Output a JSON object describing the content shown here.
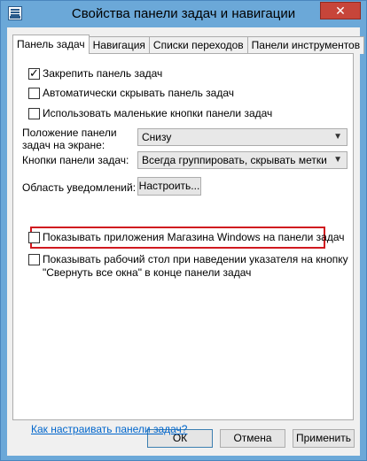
{
  "window": {
    "title": "Свойства панели задач и навигации",
    "close_glyph": "✕"
  },
  "tabs": [
    {
      "label": "Панель задач",
      "active": true
    },
    {
      "label": "Навигация",
      "active": false
    },
    {
      "label": "Списки переходов",
      "active": false
    },
    {
      "label": "Панели инструментов",
      "active": false
    }
  ],
  "taskbar": {
    "lock": {
      "label": "Закрепить панель задач",
      "checked": true
    },
    "autohide": {
      "label": "Автоматически скрывать панель задач",
      "checked": false
    },
    "small_buttons": {
      "label": "Использовать маленькие кнопки панели задач",
      "checked": false
    },
    "location": {
      "label_line1": "Положение панели",
      "label_line2": "задач на экране:",
      "value": "Снизу"
    },
    "buttons": {
      "label": "Кнопки панели задач:",
      "value": "Всегда группировать, скрывать метки"
    },
    "notification": {
      "label": "Область уведомлений:",
      "button": "Настроить..."
    },
    "store_apps": {
      "label": "Показывать приложения Магазина Windows на панели задач",
      "checked": false
    },
    "peek": {
      "label_line1": "Показывать рабочий стол при наведении указателя на кнопку",
      "label_line2": "\"Свернуть все окна\" в конце панели задач",
      "checked": false
    }
  },
  "help_link": "Как настраивать панели задач?",
  "footer": {
    "ok": "ОК",
    "cancel": "Отмена",
    "apply": "Применить"
  }
}
